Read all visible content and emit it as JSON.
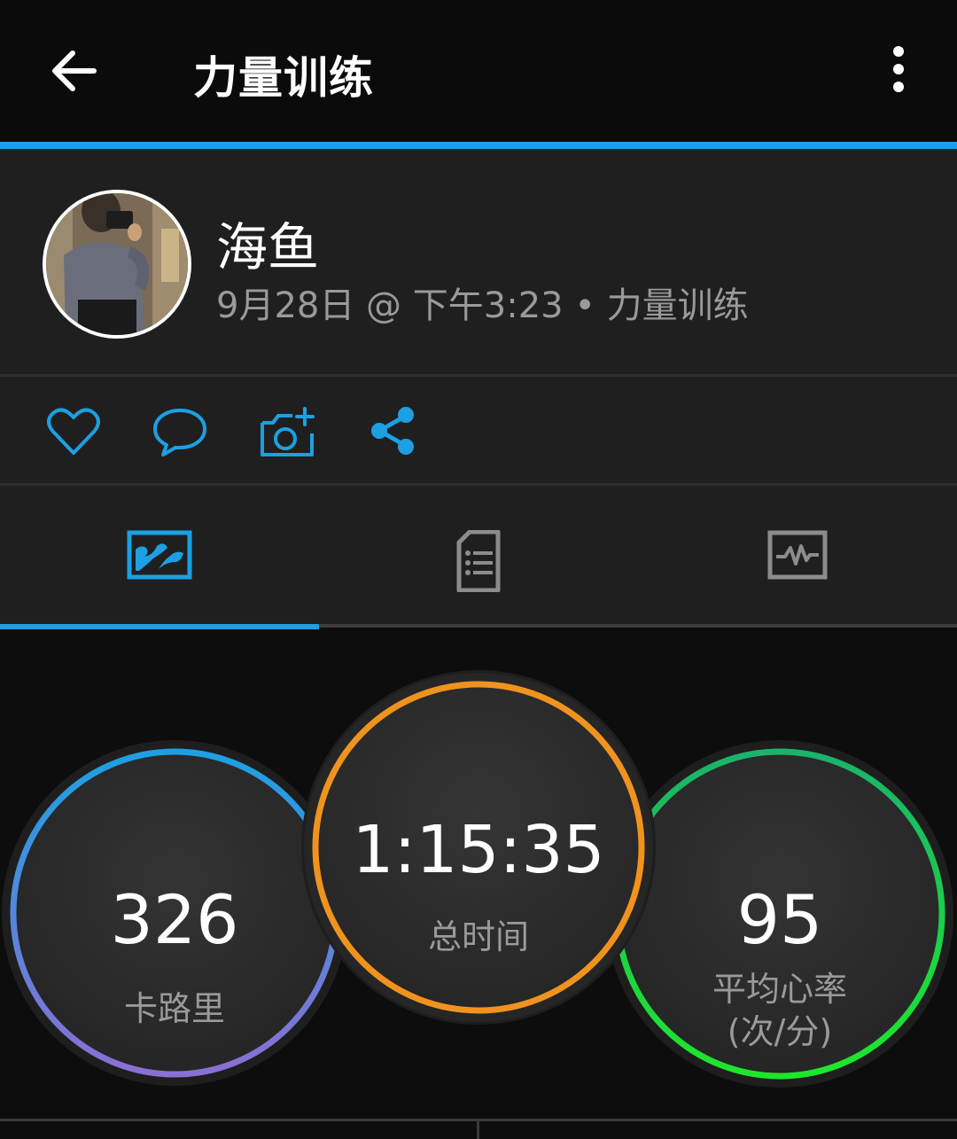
{
  "appbar": {
    "title": "力量训练",
    "back_icon": "arrow-left-icon",
    "more_icon": "more-vertical-icon"
  },
  "activity": {
    "user_name": "海鱼",
    "subtitle": "9月28日 @ 下午3:23 • 力量训练"
  },
  "actions": [
    {
      "icon": "heart-icon"
    },
    {
      "icon": "comment-icon"
    },
    {
      "icon": "add-photo-icon"
    },
    {
      "icon": "share-icon"
    }
  ],
  "tabs": [
    {
      "icon": "map-stats-icon",
      "active": true
    },
    {
      "icon": "details-list-icon",
      "active": false
    },
    {
      "icon": "chart-icon",
      "active": false
    }
  ],
  "stats": {
    "calories": {
      "value": "326",
      "label": "卡路里"
    },
    "total_time": {
      "value": "1:15:35",
      "label": "总时间"
    },
    "avg_hr": {
      "value": "95",
      "label_line1": "平均心率",
      "label_line2": "(次/分)"
    }
  },
  "colors": {
    "accent": "#1ca0e3",
    "calories_ring_top": "#1ca0e3",
    "calories_ring_bottom": "#8a6fd4",
    "time_ring": "#f0931e",
    "hr_ring_top": "#1bb36b",
    "hr_ring_bottom": "#1ee62c"
  }
}
